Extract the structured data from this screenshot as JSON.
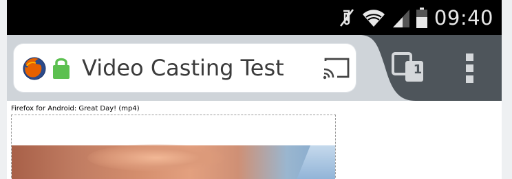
{
  "status_bar": {
    "time": "09:40",
    "icons": [
      "mute-icon",
      "wifi-icon",
      "signal-icon",
      "battery-icon"
    ]
  },
  "browser": {
    "page_title": "Video Casting Test",
    "tabs_count": "1",
    "icons": {
      "logo": "firefox-logo",
      "secure": "lock-icon",
      "cast": "cast-icon",
      "tabs": "tabs-icon",
      "menu": "overflow-menu-icon"
    },
    "colors": {
      "toolbar": "#4e555b",
      "secure_lock": "#5cc050",
      "status_bar": "#000000"
    }
  },
  "page": {
    "video_caption": "Firefox for Android: Great Day! (mp4)"
  }
}
